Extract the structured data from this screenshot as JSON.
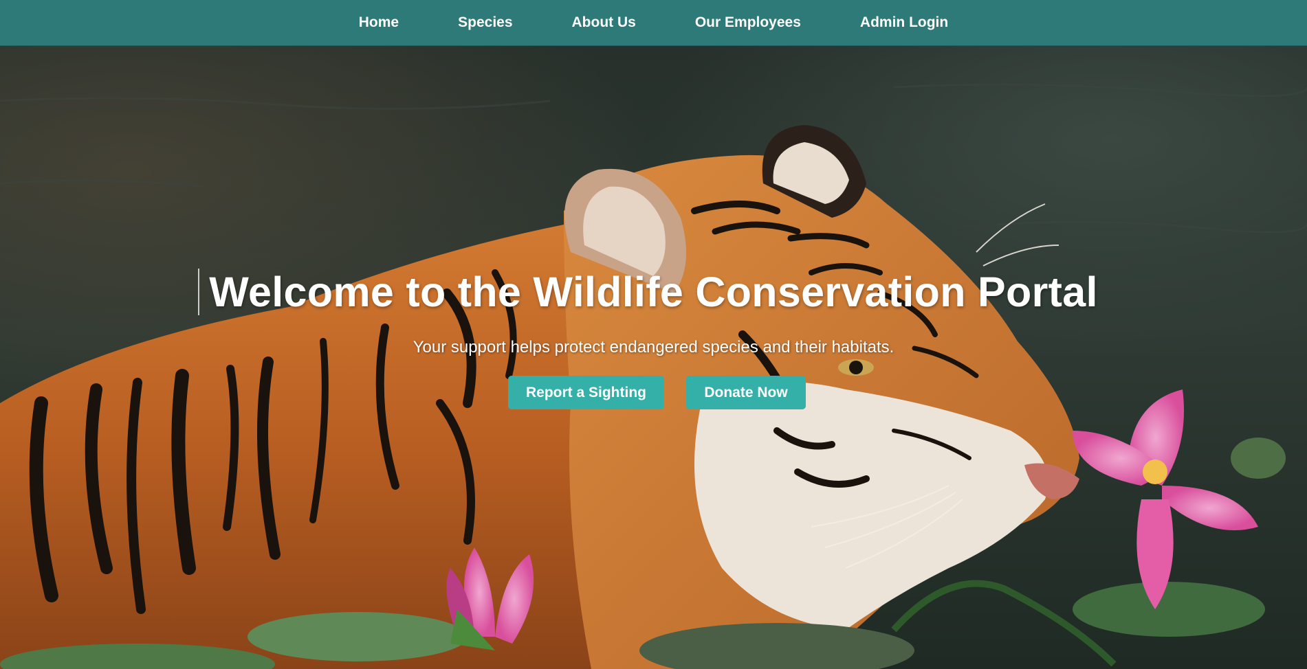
{
  "nav": {
    "items": [
      {
        "label": "Home"
      },
      {
        "label": "Species"
      },
      {
        "label": "About Us"
      },
      {
        "label": "Our Employees"
      },
      {
        "label": "Admin Login"
      }
    ]
  },
  "hero": {
    "title": "Welcome to the Wildlife Conservation Portal",
    "subtitle": "Your support helps protect endangered species and their habitats.",
    "buttons": {
      "report": "Report a Sighting",
      "donate": "Donate Now"
    },
    "background_icon": "tiger-in-water-with-lotus-image"
  },
  "colors": {
    "nav_bg": "#2d7a78",
    "button_bg": "#35b0a8",
    "text": "#ffffff"
  }
}
